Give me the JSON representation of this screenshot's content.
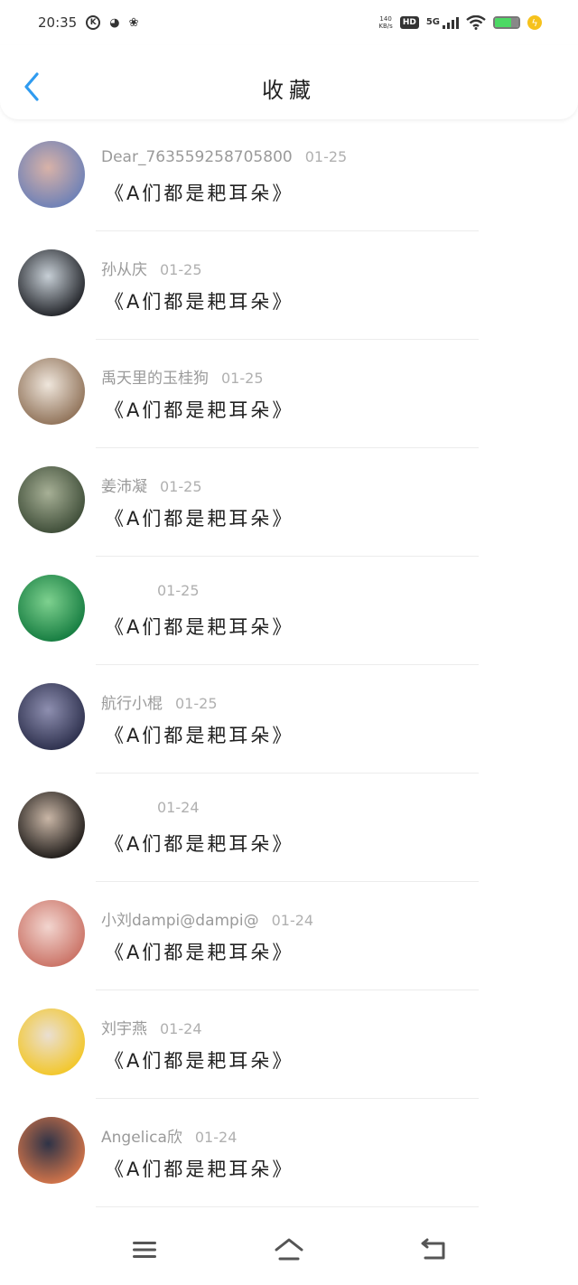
{
  "status_bar": {
    "time": "20:35",
    "speed_top": "140",
    "speed_bottom": "KB/s",
    "hd": "HD",
    "network": "5G",
    "battery_level": 0.7
  },
  "header": {
    "title": "收藏",
    "back_icon": "chevron-left-icon",
    "accent": "#2f9bf0"
  },
  "favorites": [
    {
      "user": "Dear_763559258705800",
      "date": "01-25",
      "content": "《A们都是耙耳朵》",
      "avatar_colors": [
        "#6a7fb7",
        "#d8b2a8"
      ]
    },
    {
      "user": "孙从庆",
      "date": "01-25",
      "content": "《A们都是耙耳朵》",
      "avatar_colors": [
        "#1d1f24",
        "#c7cfd6"
      ]
    },
    {
      "user": "禹天里的玉桂狗",
      "date": "01-25",
      "content": "《A们都是耙耳朵》",
      "avatar_colors": [
        "#8d6f55",
        "#efe6dc"
      ]
    },
    {
      "user": "姜沛凝",
      "date": "01-25",
      "content": "《A们都是耙耳朵》",
      "avatar_colors": [
        "#3b4a35",
        "#a7b096"
      ]
    },
    {
      "user": "",
      "date": "01-25",
      "content": "《A们都是耙耳朵》",
      "avatar_colors": [
        "#127a3e",
        "#7ed18f"
      ]
    },
    {
      "user": "航行小棍",
      "date": "01-25",
      "content": "《A们都是耙耳朵》",
      "avatar_colors": [
        "#2a2d4a",
        "#8e8fb0"
      ]
    },
    {
      "user": "",
      "date": "01-24",
      "content": "《A们都是耙耳朵》",
      "avatar_colors": [
        "#1a1715",
        "#c9b6a6"
      ]
    },
    {
      "user": "小刘dampi@dampi@",
      "date": "01-24",
      "content": "《A们都是耙耳朵》",
      "avatar_colors": [
        "#c96f62",
        "#f2d5cf"
      ]
    },
    {
      "user": "刘宇燕",
      "date": "01-24",
      "content": "《A们都是耙耳朵》",
      "avatar_colors": [
        "#f3c623",
        "#eadfd2"
      ]
    },
    {
      "user": "Angelica欣",
      "date": "01-24",
      "content": "《A们都是耙耳朵》",
      "avatar_colors": [
        "#d9774a",
        "#2e3347"
      ]
    }
  ],
  "navbar": {
    "menu_icon": "menu-icon",
    "home_icon": "home-icon",
    "back_icon": "back-icon"
  }
}
